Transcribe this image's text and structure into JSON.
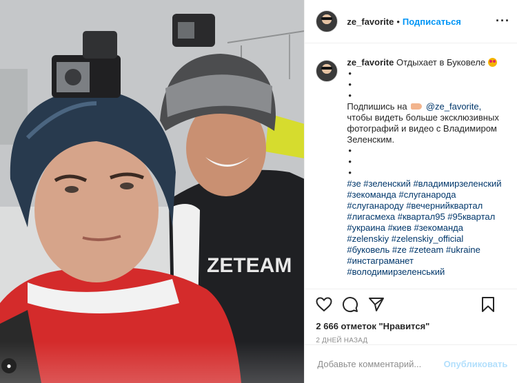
{
  "post": {
    "username": "ze_favorite",
    "separator": "•",
    "follow_label": "Подписаться",
    "more_icon": "more-horizontal-icon"
  },
  "caption": {
    "username": "ze_favorite",
    "first_line": "Отдыхает в Буковеле",
    "bullet": "•",
    "subscribe_prefix": "Подпишись на",
    "mention": "@ze_favorite,",
    "body": "чтобы видеть больше эксклюзивных фотографий и видео с Владимиром Зеленским.",
    "hashtags": "#зе #зеленский #владимирзеленский #зекоманда #слуганарода #слуганароду #вечернийквартал #лигасмеха #квартал95 #95квартал #украина #киев #зекоманда #zelenskiy #zelenskiy_official #буковель #ze #zeteam #ukraine #инстаграманет #володимирзеленський"
  },
  "actions": {
    "like_icon": "heart-icon",
    "comment_icon": "comment-icon",
    "share_icon": "paper-plane-icon",
    "save_icon": "bookmark-icon"
  },
  "likes": "2 666 отметок \"Нравится\"",
  "time": "2 дней назад",
  "comment": {
    "placeholder": "Добавьте комментарий...",
    "publish_label": "Опубликовать"
  },
  "colors": {
    "link_blue": "#0095f6",
    "hashtag_blue": "#00376b",
    "publish_disabled": "#b2dffc",
    "border": "#efefef"
  }
}
